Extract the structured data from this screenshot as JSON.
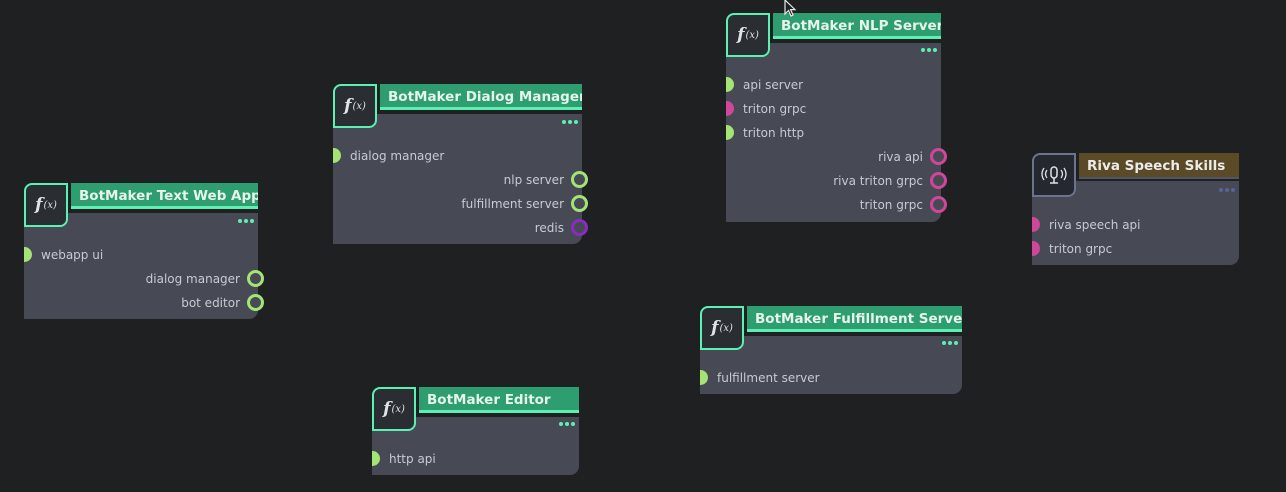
{
  "nodes": {
    "text_web_app": {
      "title": "BotMaker Text Web App",
      "icon": "function-icon",
      "inputs": [
        "webapp ui"
      ],
      "outputs": [
        "dialog manager",
        "bot editor"
      ]
    },
    "dialog_manager": {
      "title": "BotMaker Dialog Manager",
      "icon": "function-icon",
      "inputs": [
        "dialog manager"
      ],
      "outputs": [
        "nlp server",
        "fulfillment server",
        "redis"
      ]
    },
    "editor": {
      "title": "BotMaker Editor",
      "icon": "function-icon",
      "inputs": [
        "http api"
      ]
    },
    "nlp_server": {
      "title": "BotMaker NLP Server",
      "icon": "function-icon",
      "inputs": [
        "api server",
        "triton grpc",
        "triton http"
      ],
      "outputs": [
        "riva api",
        "riva triton grpc",
        "triton grpc"
      ]
    },
    "fulfillment_server": {
      "title": "BotMaker Fulfillment Server",
      "icon": "function-icon",
      "inputs": [
        "fulfillment server"
      ]
    },
    "riva": {
      "title": "Riva Speech Skills",
      "icon": "microphone-icon",
      "inputs": [
        "riva speech api",
        "triton grpc"
      ]
    }
  },
  "icon_text": {
    "f": "f",
    "x": "(x)"
  },
  "colors": {
    "background": "#1f2022",
    "node_body": "#474a55",
    "header": "#2e9d70",
    "accent": "#5cf0b3",
    "port_green": "#a4e374",
    "port_pink": "#d0479a",
    "port_purple": "#8b2bc4",
    "riva_header": "#5a4a25"
  }
}
